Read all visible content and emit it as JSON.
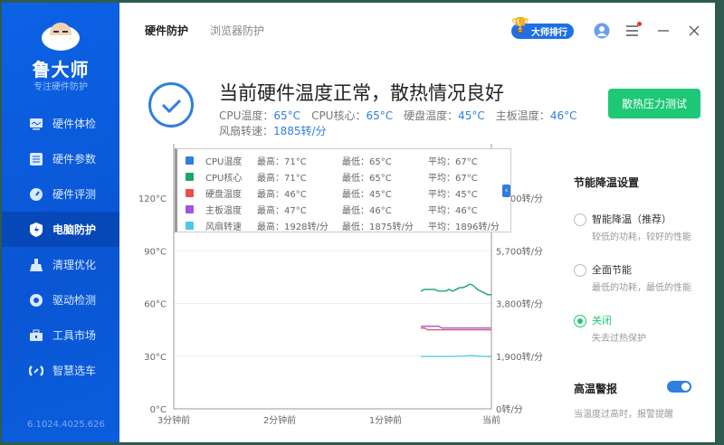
{
  "sidebar": {
    "brand": "鲁大师",
    "slogan": "专注硬件防护",
    "version": "6.1024.4025.626",
    "items": [
      {
        "label": "硬件体检",
        "icon": "monitor-icon"
      },
      {
        "label": "硬件参数",
        "icon": "sliders-icon"
      },
      {
        "label": "硬件评测",
        "icon": "gauge-icon"
      },
      {
        "label": "电脑防护",
        "icon": "shield-icon",
        "active": true
      },
      {
        "label": "清理优化",
        "icon": "broom-icon"
      },
      {
        "label": "驱动检测",
        "icon": "gear-icon"
      },
      {
        "label": "工具市场",
        "icon": "toolbox-icon"
      },
      {
        "label": "智慧选车",
        "icon": "car-sync-icon"
      }
    ]
  },
  "tabs": [
    {
      "label": "硬件防护",
      "active": true
    },
    {
      "label": "浏览器防护"
    }
  ],
  "topbar": {
    "rank_label": "大师排行"
  },
  "status": {
    "headline": "当前硬件温度正常，散热情况良好",
    "cpu_temp_label": "CPU温度：",
    "cpu_temp": "65°C",
    "cpu_core_label": "CPU核心：",
    "cpu_core": "65°C",
    "disk_label": "硬盘温度：",
    "disk": "45°C",
    "board_label": "主板温度：",
    "board": "46°C",
    "fan_label": "风扇转速：",
    "fan": "1885转/分"
  },
  "stress_test_label": "散热压力测试",
  "settings": {
    "title": "节能降温设置",
    "options": [
      {
        "title": "智能降温（推荐）",
        "desc": "较低的功耗，较好的性能",
        "selected": false
      },
      {
        "title": "全面节能",
        "desc": "最低的功耗，最低的性能",
        "selected": false
      },
      {
        "title": "关闭",
        "desc": "失去过热保护",
        "selected": true
      }
    ],
    "alarm_title": "高温警报",
    "alarm_on": true,
    "alarm_desc": "当温度过高时，报警提醒"
  },
  "legend": [
    {
      "name": "CPU温度",
      "max": "最高：71°C",
      "min": "最低：65°C",
      "avg": "平均：67°C",
      "color": "#2e7fe0"
    },
    {
      "name": "CPU核心",
      "max": "最高：71°C",
      "min": "最低：65°C",
      "avg": "平均：67°C",
      "color": "#1aa86a"
    },
    {
      "name": "硬盘温度",
      "max": "最高：46°C",
      "min": "最低：45°C",
      "avg": "平均：45°C",
      "color": "#ef4d4d"
    },
    {
      "name": "主板温度",
      "max": "最高：47°C",
      "min": "最低：46°C",
      "avg": "平均：46°C",
      "color": "#9b55e8"
    },
    {
      "name": "风扇转速",
      "max": "最高：1928转/分",
      "min": "最低：1875转/分",
      "avg": "平均：1896转/分",
      "color": "#4cc8e8"
    }
  ],
  "chart_data": {
    "type": "line",
    "x_ticks": [
      "3分钟前",
      "2分钟前",
      "1分钟前",
      "当前"
    ],
    "y_left_ticks": [
      "0°C",
      "30°C",
      "60°C",
      "90°C",
      "120°C"
    ],
    "y_left_range": [
      0,
      120
    ],
    "y_right_ticks": [
      "0转/分",
      "1,900转/分",
      "3,800转/分",
      "5,700转/分",
      "7,600转/分"
    ],
    "y_right_range": [
      0,
      7600
    ],
    "x_seconds_ago": [
      40,
      38,
      36,
      34,
      32,
      30,
      28,
      26,
      24,
      22,
      20,
      18,
      16,
      14,
      12,
      10,
      8,
      6,
      4,
      2,
      0
    ],
    "series": [
      {
        "name": "CPU温度",
        "axis": "left",
        "values": [
          67,
          68,
          68,
          68,
          68,
          67,
          67,
          67,
          68,
          67,
          68,
          69,
          69,
          70,
          71,
          70,
          68,
          67,
          66,
          65,
          65
        ]
      },
      {
        "name": "CPU核心",
        "axis": "left",
        "values": [
          67,
          68,
          68,
          68,
          68,
          67,
          67,
          67,
          68,
          67,
          68,
          69,
          69,
          70,
          71,
          70,
          68,
          67,
          66,
          65,
          65
        ]
      },
      {
        "name": "硬盘温度",
        "axis": "left",
        "values": [
          46,
          46,
          45,
          45,
          45,
          45,
          45,
          45,
          45,
          45,
          45,
          45,
          45,
          45,
          45,
          45,
          45,
          45,
          45,
          45,
          45
        ]
      },
      {
        "name": "主板温度",
        "axis": "left",
        "values": [
          47,
          47,
          47,
          47,
          47,
          47,
          46,
          46,
          46,
          46,
          46,
          46,
          46,
          46,
          46,
          46,
          46,
          46,
          46,
          46,
          46
        ]
      },
      {
        "name": "风扇转速",
        "axis": "right",
        "values": [
          1890,
          1890,
          1890,
          1890,
          1890,
          1890,
          1890,
          1890,
          1890,
          1890,
          1895,
          1895,
          1900,
          1910,
          1920,
          1915,
          1905,
          1895,
          1890,
          1885,
          1885
        ]
      }
    ]
  }
}
